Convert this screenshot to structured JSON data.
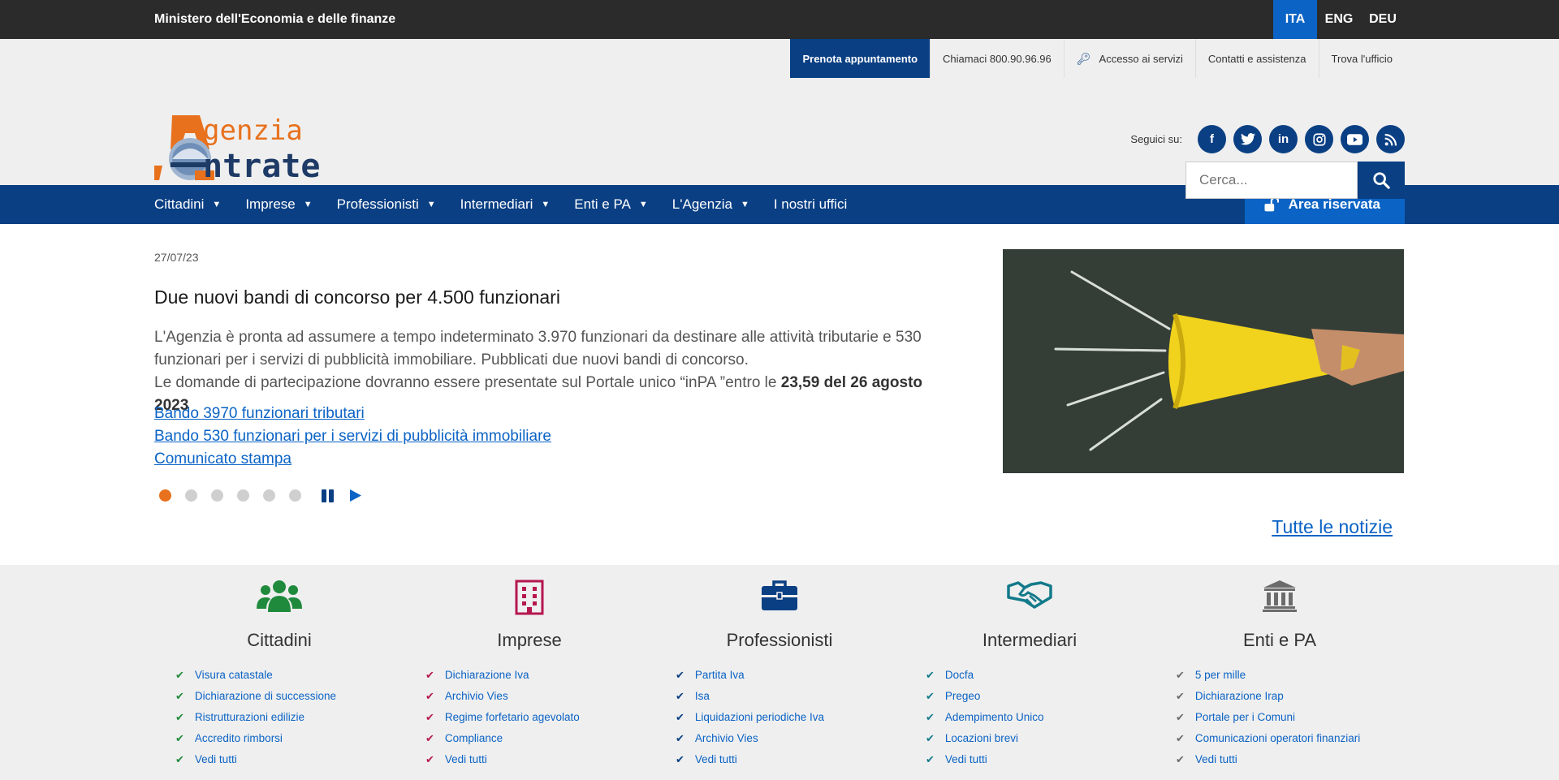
{
  "topbar": {
    "ministry": "Ministero dell'Economia e delle finanze",
    "languages": [
      {
        "label": "ITA",
        "active": true
      },
      {
        "label": "ENG",
        "active": false
      },
      {
        "label": "DEU",
        "active": false
      }
    ]
  },
  "utility": {
    "book": "Prenota appuntamento",
    "call": "Chiamaci 800.90.96.96",
    "access": "Accesso ai servizi",
    "contacts": "Contatti e assistenza",
    "office": "Trova l'ufficio"
  },
  "logo": {
    "line1": "genzia",
    "line2": "ntrate"
  },
  "social": {
    "label": "Seguici su:",
    "icons": [
      "facebook-icon",
      "twitter-icon",
      "linkedin-icon",
      "instagram-icon",
      "youtube-icon",
      "rss-icon"
    ]
  },
  "search": {
    "placeholder": "Cerca..."
  },
  "nav": {
    "items": [
      "Cittadini",
      "Imprese",
      "Professionisti",
      "Intermediari",
      "Enti e PA",
      "L'Agenzia",
      "I nostri uffici"
    ],
    "area": "Area riservata"
  },
  "hero": {
    "date": "27/07/23",
    "title": "Due nuovi bandi di concorso per 4.500 funzionari",
    "text1": "L'Agenzia è pronta ad assumere a tempo indeterminato 3.970 funzionari da destinare alle attività tributarie e 530 funzionari per i servizi di pubblicità immobiliare. Pubblicati due nuovi bandi di concorso.",
    "text2": "Le domande di partecipazione dovranno essere presentate sul Portale unico “inPA ”entro le ",
    "text2_bold": "23,59 del 26 agosto 2023",
    "links": [
      "Bando 3970 funzionari tributari",
      "Bando 530 funzionari per i servizi di pubblicità immobiliare",
      "Comunicato stampa"
    ],
    "all_news": "Tutte le notizie"
  },
  "colors": {
    "dark": "#2b2b2b",
    "navy": "#0a3f83",
    "blue": "#0b63c5",
    "orange": "#e8711d",
    "green": "#1f8a3c",
    "magenta": "#b5174f",
    "teal": "#137a8a",
    "grey": "#6b6b6b"
  },
  "categories": [
    {
      "title": "Cittadini",
      "icon": "users-icon",
      "color": "#1f8a3c",
      "links": [
        "Visura catastale",
        "Dichiarazione di successione",
        "Ristrutturazioni edilizie",
        "Accredito rimborsi",
        "Vedi tutti"
      ]
    },
    {
      "title": "Imprese",
      "icon": "building-icon",
      "color": "#b5174f",
      "links": [
        "Dichiarazione Iva",
        "Archivio Vies",
        "Regime forfetario agevolato",
        "Compliance",
        "Vedi tutti"
      ]
    },
    {
      "title": "Professionisti",
      "icon": "briefcase-icon",
      "color": "#0a3f83",
      "links": [
        "Partita Iva",
        "Isa",
        "Liquidazioni periodiche Iva",
        "Archivio Vies",
        "Vedi tutti"
      ]
    },
    {
      "title": "Intermediari",
      "icon": "handshake-icon",
      "color": "#137a8a",
      "links": [
        "Docfa",
        "Pregeo",
        "Adempimento Unico",
        "Locazioni brevi",
        "Vedi tutti"
      ]
    },
    {
      "title": "Enti e PA",
      "icon": "bank-icon",
      "color": "#6b6b6b",
      "links": [
        "5 per mille",
        "Dichiarazione Irap",
        "Portale per i Comuni",
        "Comunicazioni operatori finanziari",
        "Vedi tutti"
      ]
    }
  ]
}
